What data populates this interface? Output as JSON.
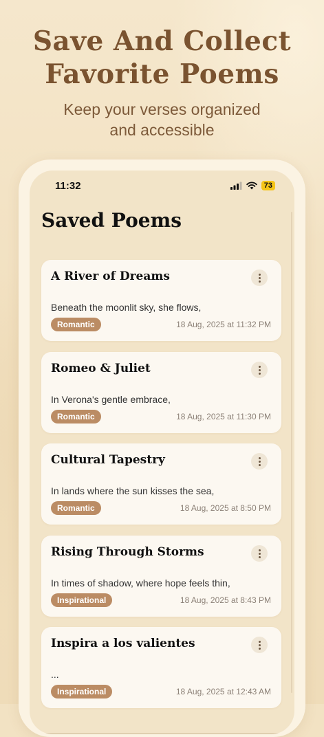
{
  "hero": {
    "title_line1": "Save And Collect",
    "title_line2": "Favorite Poems",
    "subtitle_line1": "Keep your verses organized",
    "subtitle_line2": "and accessible"
  },
  "status_bar": {
    "time": "11:32",
    "battery": "73"
  },
  "screen": {
    "title": "Saved Poems"
  },
  "poems": [
    {
      "title": "A River of Dreams",
      "excerpt": "Beneath the moonlit sky, she flows,",
      "tag": "Romantic",
      "date": "18 Aug, 2025 at 11:32 PM"
    },
    {
      "title": "Romeo & Juliet",
      "excerpt": "In Verona's gentle embrace,",
      "tag": "Romantic",
      "date": "18 Aug, 2025 at 11:30 PM"
    },
    {
      "title": "Cultural Tapestry",
      "excerpt": "In lands where the sun kisses the sea,",
      "tag": "Romantic",
      "date": "18 Aug, 2025 at 8:50 PM"
    },
    {
      "title": "Rising Through Storms",
      "excerpt": "In times of shadow, where hope feels thin,",
      "tag": "Inspirational",
      "date": "18 Aug, 2025 at 8:43 PM"
    },
    {
      "title": "Inspira a los valientes",
      "excerpt": "...",
      "tag": "Inspirational",
      "date": "18 Aug, 2025 at 12:43 AM"
    }
  ],
  "icons": {
    "signal": "cellular-signal-icon",
    "wifi": "wifi-icon",
    "battery": "battery-icon",
    "more": "more-vertical-icon"
  },
  "colors": {
    "accent_brown": "#7a5330",
    "tag_brown": "#bb8c64",
    "battery_yellow": "#f5c518",
    "background": "#f2e2c3"
  }
}
